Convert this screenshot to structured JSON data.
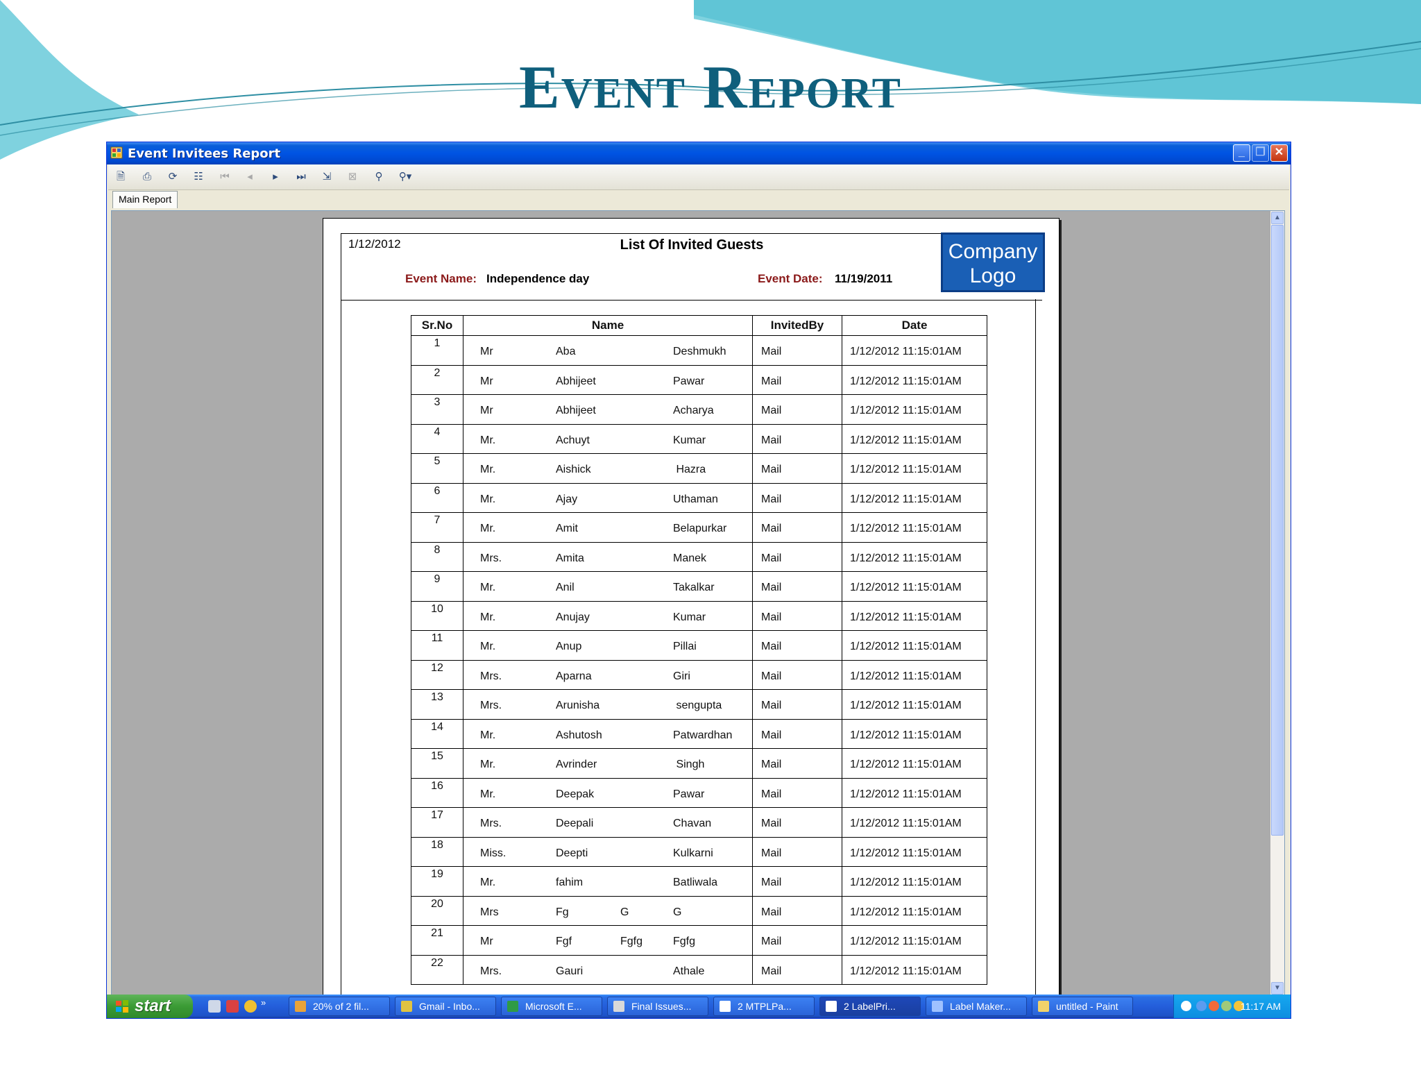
{
  "slide": {
    "title": "Event Report"
  },
  "window": {
    "title": "Event Invitees Report",
    "tab_label": "Main Report"
  },
  "toolbar": {
    "icons": [
      "export-icon",
      "print-icon",
      "refresh-icon",
      "group-tree-icon",
      "first-page-icon",
      "previous-page-icon",
      "next-page-icon",
      "last-page-icon",
      "goto-page-icon",
      "stop-icon",
      "search-icon",
      "zoom-icon"
    ]
  },
  "report": {
    "print_date": "1/12/2012",
    "heading": "List Of Invited Guests",
    "event_name_label": "Event Name:",
    "event_name": "Independence day",
    "event_date_label": "Event Date:",
    "event_date": "11/19/2011",
    "logo_text_1": "Company",
    "logo_text_2": "Logo",
    "columns": [
      "Sr.No",
      "Name",
      "InvitedBy",
      "Date"
    ],
    "rows": [
      {
        "no": "1",
        "title": "Mr",
        "first": "Aba",
        "middle": "",
        "last": "Deshmukh",
        "invited_by": "Mail",
        "date": "1/12/2012  11:15:01AM"
      },
      {
        "no": "2",
        "title": "Mr",
        "first": "Abhijeet",
        "middle": "",
        "last": "Pawar",
        "invited_by": "Mail",
        "date": "1/12/2012  11:15:01AM"
      },
      {
        "no": "3",
        "title": "Mr",
        "first": "Abhijeet",
        "middle": "",
        "last": "Acharya",
        "invited_by": "Mail",
        "date": "1/12/2012  11:15:01AM"
      },
      {
        "no": "4",
        "title": "Mr.",
        "first": "Achuyt",
        "middle": "",
        "last": "Kumar",
        "invited_by": "Mail",
        "date": "1/12/2012  11:15:01AM"
      },
      {
        "no": "5",
        "title": "Mr.",
        "first": "Aishick",
        "middle": "",
        "last": " Hazra",
        "invited_by": "Mail",
        "date": "1/12/2012  11:15:01AM"
      },
      {
        "no": "6",
        "title": "Mr.",
        "first": "Ajay",
        "middle": "",
        "last": "Uthaman",
        "invited_by": "Mail",
        "date": "1/12/2012  11:15:01AM"
      },
      {
        "no": "7",
        "title": "Mr.",
        "first": "Amit",
        "middle": "",
        "last": "Belapurkar",
        "invited_by": "Mail",
        "date": "1/12/2012  11:15:01AM"
      },
      {
        "no": "8",
        "title": "Mrs.",
        "first": "Amita",
        "middle": "",
        "last": "Manek",
        "invited_by": "Mail",
        "date": "1/12/2012  11:15:01AM"
      },
      {
        "no": "9",
        "title": "Mr.",
        "first": "Anil",
        "middle": "",
        "last": "Takalkar",
        "invited_by": "Mail",
        "date": "1/12/2012  11:15:01AM"
      },
      {
        "no": "10",
        "title": "Mr.",
        "first": "Anujay",
        "middle": "",
        "last": "Kumar",
        "invited_by": "Mail",
        "date": "1/12/2012  11:15:01AM"
      },
      {
        "no": "11",
        "title": "Mr.",
        "first": "Anup",
        "middle": "",
        "last": "Pillai",
        "invited_by": "Mail",
        "date": "1/12/2012  11:15:01AM"
      },
      {
        "no": "12",
        "title": "Mrs.",
        "first": "Aparna",
        "middle": "",
        "last": "Giri",
        "invited_by": "Mail",
        "date": "1/12/2012  11:15:01AM"
      },
      {
        "no": "13",
        "title": "Mrs.",
        "first": "Arunisha",
        "middle": "",
        "last": " sengupta",
        "invited_by": "Mail",
        "date": "1/12/2012  11:15:01AM"
      },
      {
        "no": "14",
        "title": "Mr.",
        "first": "Ashutosh",
        "middle": "",
        "last": "Patwardhan",
        "invited_by": "Mail",
        "date": "1/12/2012  11:15:01AM"
      },
      {
        "no": "15",
        "title": "Mr.",
        "first": "Avrinder",
        "middle": "",
        "last": " Singh",
        "invited_by": "Mail",
        "date": "1/12/2012  11:15:01AM"
      },
      {
        "no": "16",
        "title": "Mr.",
        "first": "Deepak",
        "middle": "",
        "last": "Pawar",
        "invited_by": "Mail",
        "date": "1/12/2012  11:15:01AM"
      },
      {
        "no": "17",
        "title": "Mrs.",
        "first": "Deepali",
        "middle": "",
        "last": "Chavan",
        "invited_by": "Mail",
        "date": "1/12/2012  11:15:01AM"
      },
      {
        "no": "18",
        "title": "Miss.",
        "first": "Deepti",
        "middle": "",
        "last": "Kulkarni",
        "invited_by": "Mail",
        "date": "1/12/2012  11:15:01AM"
      },
      {
        "no": "19",
        "title": "Mr.",
        "first": "fahim",
        "middle": "",
        "last": "Batliwala",
        "invited_by": "Mail",
        "date": "1/12/2012  11:15:01AM"
      },
      {
        "no": "20",
        "title": "Mrs",
        "first": "Fg",
        "middle": "G",
        "last": "G",
        "invited_by": "Mail",
        "date": "1/12/2012  11:15:01AM"
      },
      {
        "no": "21",
        "title": "Mr",
        "first": "Fgf",
        "middle": "Fgfg",
        "last": "Fgfg",
        "invited_by": "Mail",
        "date": "1/12/2012  11:15:01AM"
      },
      {
        "no": "22",
        "title": "Mrs.",
        "first": "Gauri",
        "middle": "",
        "last": "Athale",
        "invited_by": "Mail",
        "date": "1/12/2012  11:15:01AM"
      }
    ]
  },
  "taskbar": {
    "start_label": "start",
    "tasks": [
      {
        "label": "20% of 2 fil...",
        "icon": "download-icon",
        "color": "#e8a33a"
      },
      {
        "label": "Gmail - Inbo...",
        "icon": "chrome-icon",
        "color": "#e0c341"
      },
      {
        "label": "Microsoft E...",
        "icon": "excel-icon",
        "color": "#2f9b45"
      },
      {
        "label": "Final Issues...",
        "icon": "document-icon",
        "color": "#d9d9d9"
      },
      {
        "label": "2 MTPLPa...",
        "icon": "window-icon",
        "color": "#ffffff"
      },
      {
        "label": "2 LabelPri...",
        "icon": "window-icon",
        "color": "#ffffff"
      },
      {
        "label": "Label Maker...",
        "icon": "table-icon",
        "color": "#9fc1ff"
      },
      {
        "label": "untitled - Paint",
        "icon": "paint-icon",
        "color": "#f2d36b"
      }
    ],
    "clock": "11:17 AM"
  }
}
